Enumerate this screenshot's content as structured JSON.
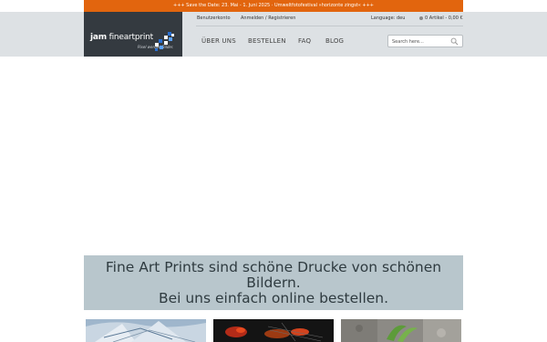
{
  "promo": {
    "text": "+++ Save the Date: 23. Mai - 1. Juni 2025 · Umweltfotofestival »horizonte zingst« +++"
  },
  "logo": {
    "brand_bold": "jam",
    "brand_rest": "fineartprint",
    "tagline": "Pixel werden Bilder."
  },
  "toplinks": {
    "account": "Benutzerkonto",
    "login": "Anmelden / Registrieren",
    "language": "Language: deu",
    "cart": "0 Artikel - 0,00 €"
  },
  "nav": {
    "items": [
      "ÜBER UNS",
      "BESTELLEN",
      "FAQ",
      "BLOG"
    ]
  },
  "search": {
    "placeholder": "Search here..."
  },
  "tagline": {
    "line1": "Fine Art Prints sind schöne Drucke von schönen",
    "line2": "Bildern.",
    "line3": "Bei uns einfach online bestellen."
  },
  "colors": {
    "promo": "#e2650e",
    "header": "#dde1e4",
    "logo_bg": "#343a40",
    "tagline_bg": "#b8c6cc"
  },
  "icons": {
    "search": "search-icon",
    "cart": "cart-icon"
  }
}
